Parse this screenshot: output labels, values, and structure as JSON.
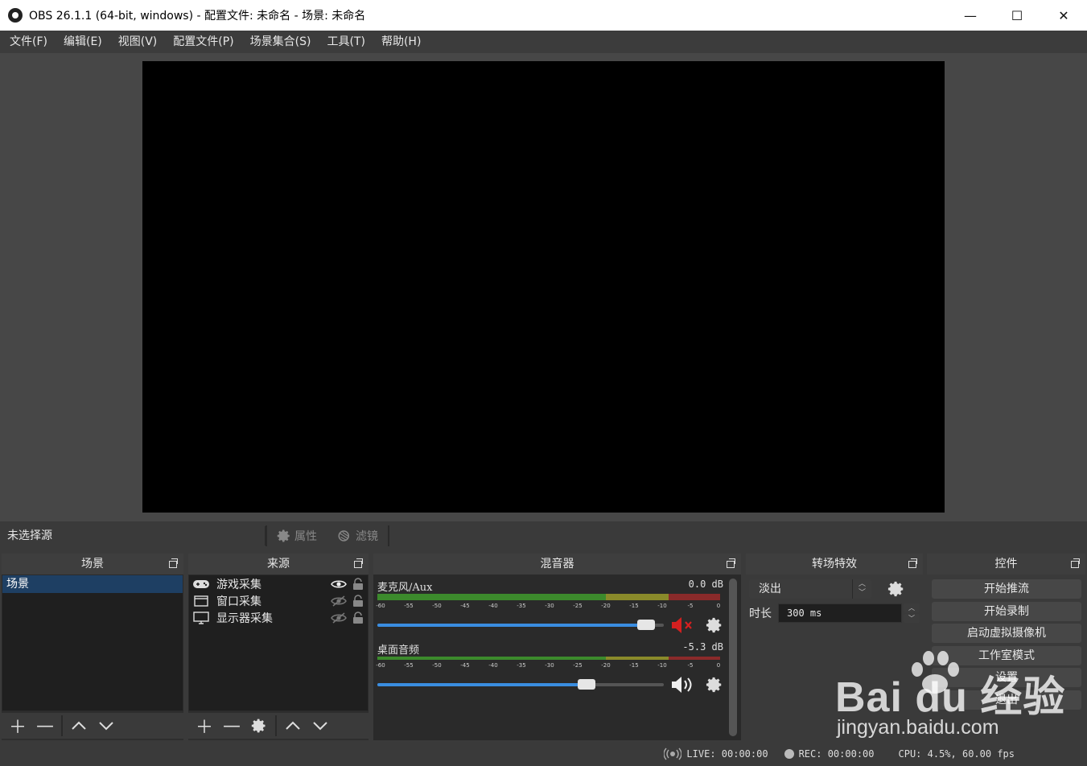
{
  "window": {
    "title": "OBS 26.1.1 (64-bit, windows) - 配置文件: 未命名 - 场景: 未命名",
    "minimize_glyph": "—",
    "maximize_glyph": "☐",
    "close_glyph": "✕"
  },
  "menu": [
    "文件(F)",
    "编辑(E)",
    "视图(V)",
    "配置文件(P)",
    "场景集合(S)",
    "工具(T)",
    "帮助(H)"
  ],
  "source_toolbar": {
    "no_selection": "未选择源",
    "properties": "属性",
    "filters": "滤镜"
  },
  "docks": {
    "scenes": {
      "title": "场景",
      "items": [
        "场景"
      ]
    },
    "sources": {
      "title": "来源",
      "items": [
        {
          "name": "游戏采集",
          "icon": "gamepad-icon",
          "visible": true
        },
        {
          "name": "窗口采集",
          "icon": "window-icon",
          "visible": false
        },
        {
          "name": "显示器采集",
          "icon": "monitor-icon",
          "visible": false
        }
      ]
    },
    "mixer": {
      "title": "混音器",
      "tick_labels": [
        "-60",
        "-55",
        "-50",
        "-45",
        "-40",
        "-35",
        "-30",
        "-25",
        "-20",
        "-15",
        "-10",
        "-5",
        "0"
      ],
      "channels": [
        {
          "name": "麦克风/Aux",
          "db": "0.0 dB",
          "volume": 0.97,
          "muted": true
        },
        {
          "name": "桌面音频",
          "db": "-5.3 dB",
          "volume": 0.76,
          "muted": false
        }
      ]
    },
    "transitions": {
      "title": "转场特效",
      "selected": "淡出",
      "duration_label": "时长",
      "duration_value": "300 ms"
    },
    "controls": {
      "title": "控件",
      "buttons": [
        "开始推流",
        "开始录制",
        "启动虚拟摄像机",
        "工作室模式",
        "设置",
        "退出"
      ]
    }
  },
  "status": {
    "live": "LIVE: 00:00:00",
    "rec": "REC: 00:00:00",
    "cpu": "CPU: 4.5%, 60.00 fps"
  },
  "watermark": {
    "logo": "Bai du 经验",
    "url": "jingyan.baidu.com"
  },
  "colors": {
    "accent": "#3a8de0",
    "selection": "#1e3f63",
    "muted": "#d42020"
  }
}
